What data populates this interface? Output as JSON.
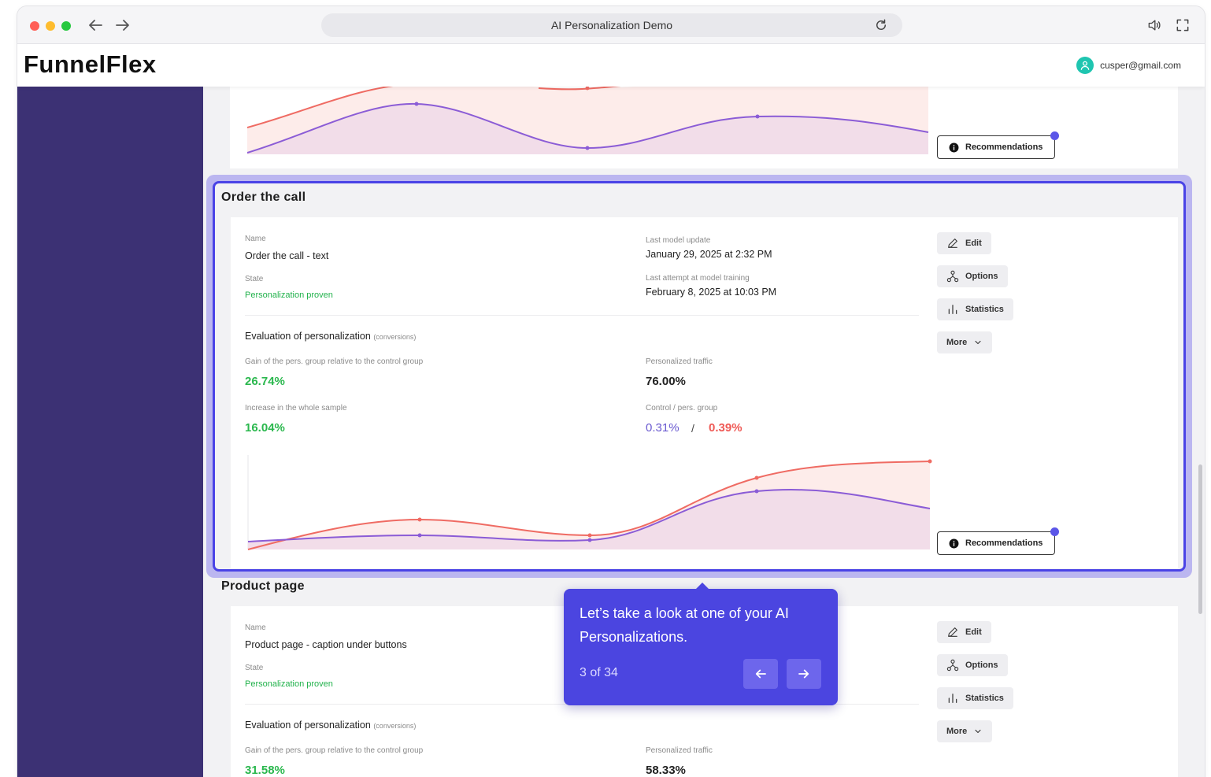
{
  "browser": {
    "title": "AI Personalization Demo"
  },
  "app": {
    "logo": "FunnelFlex",
    "user_email": "cusper@gmail.com"
  },
  "sections": [
    {
      "title": "Order the call",
      "name_label": "Name",
      "name": "Order the call - text",
      "state_label": "State",
      "state": "Personalization proven",
      "last_update_label": "Last model update",
      "last_update": "January 29, 2025 at 2:32 PM",
      "last_attempt_label": "Last attempt at model training",
      "last_attempt": "February 8, 2025 at 10:03 PM",
      "eval_title": "Evaluation of personalization",
      "eval_note": "(conversions)",
      "gain_label": "Gain of the pers. group relative to the control group",
      "gain": "26.74%",
      "traffic_label": "Personalized traffic",
      "traffic": "76.00%",
      "increase_label": "Increase in the whole sample",
      "increase": "16.04%",
      "control_label": "Control / pers. group",
      "control_value": "0.31%",
      "separator": "/",
      "pers_value": "0.39%"
    },
    {
      "title": "Product page",
      "name_label": "Name",
      "name": "Product page - caption under buttons",
      "state_label": "State",
      "state": "Personalization proven",
      "eval_title": "Evaluation of personalization",
      "eval_note": "(conversions)",
      "gain_label": "Gain of the pers. group relative to the control group",
      "gain": "31.58%",
      "traffic_label": "Personalized traffic",
      "traffic": "58.33%"
    }
  ],
  "actions": {
    "edit": "Edit",
    "options": "Options",
    "statistics": "Statistics",
    "more": "More",
    "recommendations": "Recommendations"
  },
  "tooltip": {
    "text": "Let’s take a look at one of your AI Personalizations.",
    "counter": "3 of 34"
  },
  "colors": {
    "sidebar": "#3c3174",
    "accent": "#4a43e6",
    "green": "#2bb84e",
    "red_line": "#ef6b63",
    "purple_line": "#8b5cd6"
  },
  "icons": [
    "back-arrow-icon",
    "forward-arrow-icon",
    "reload-icon",
    "speaker-icon",
    "fullscreen-icon",
    "user-icon",
    "pencil-icon",
    "options-icon",
    "statistics-icon",
    "chevron-down-icon",
    "info-icon",
    "arrow-left-icon",
    "arrow-right-icon"
  ]
}
